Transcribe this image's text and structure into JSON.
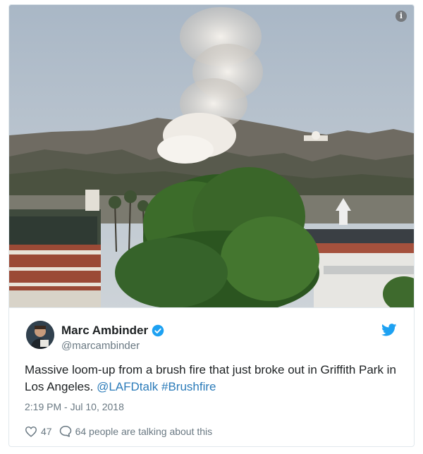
{
  "tweet": {
    "author_name": "Marc Ambinder",
    "handle": "@marcambinder",
    "text_main": "Massive loom-up from a brush fire that just broke out in Griffith Park in Los Angeles. ",
    "mention": "@LAFDtalk",
    "hashtag": "#Brushfire",
    "timestamp": "2:19 PM - Jul 10, 2018",
    "likes": "47",
    "conversation": "64 people are talking about this"
  },
  "icons": {
    "info": "info-icon",
    "verified": "verified-badge-icon",
    "brand": "twitter-bird-icon",
    "like": "heart-icon",
    "reply": "speech-bubble-icon"
  },
  "colors": {
    "link": "#2b7bb9",
    "verified": "#1da1f2",
    "twitter": "#1da1f2",
    "secondary_text": "#697882"
  }
}
